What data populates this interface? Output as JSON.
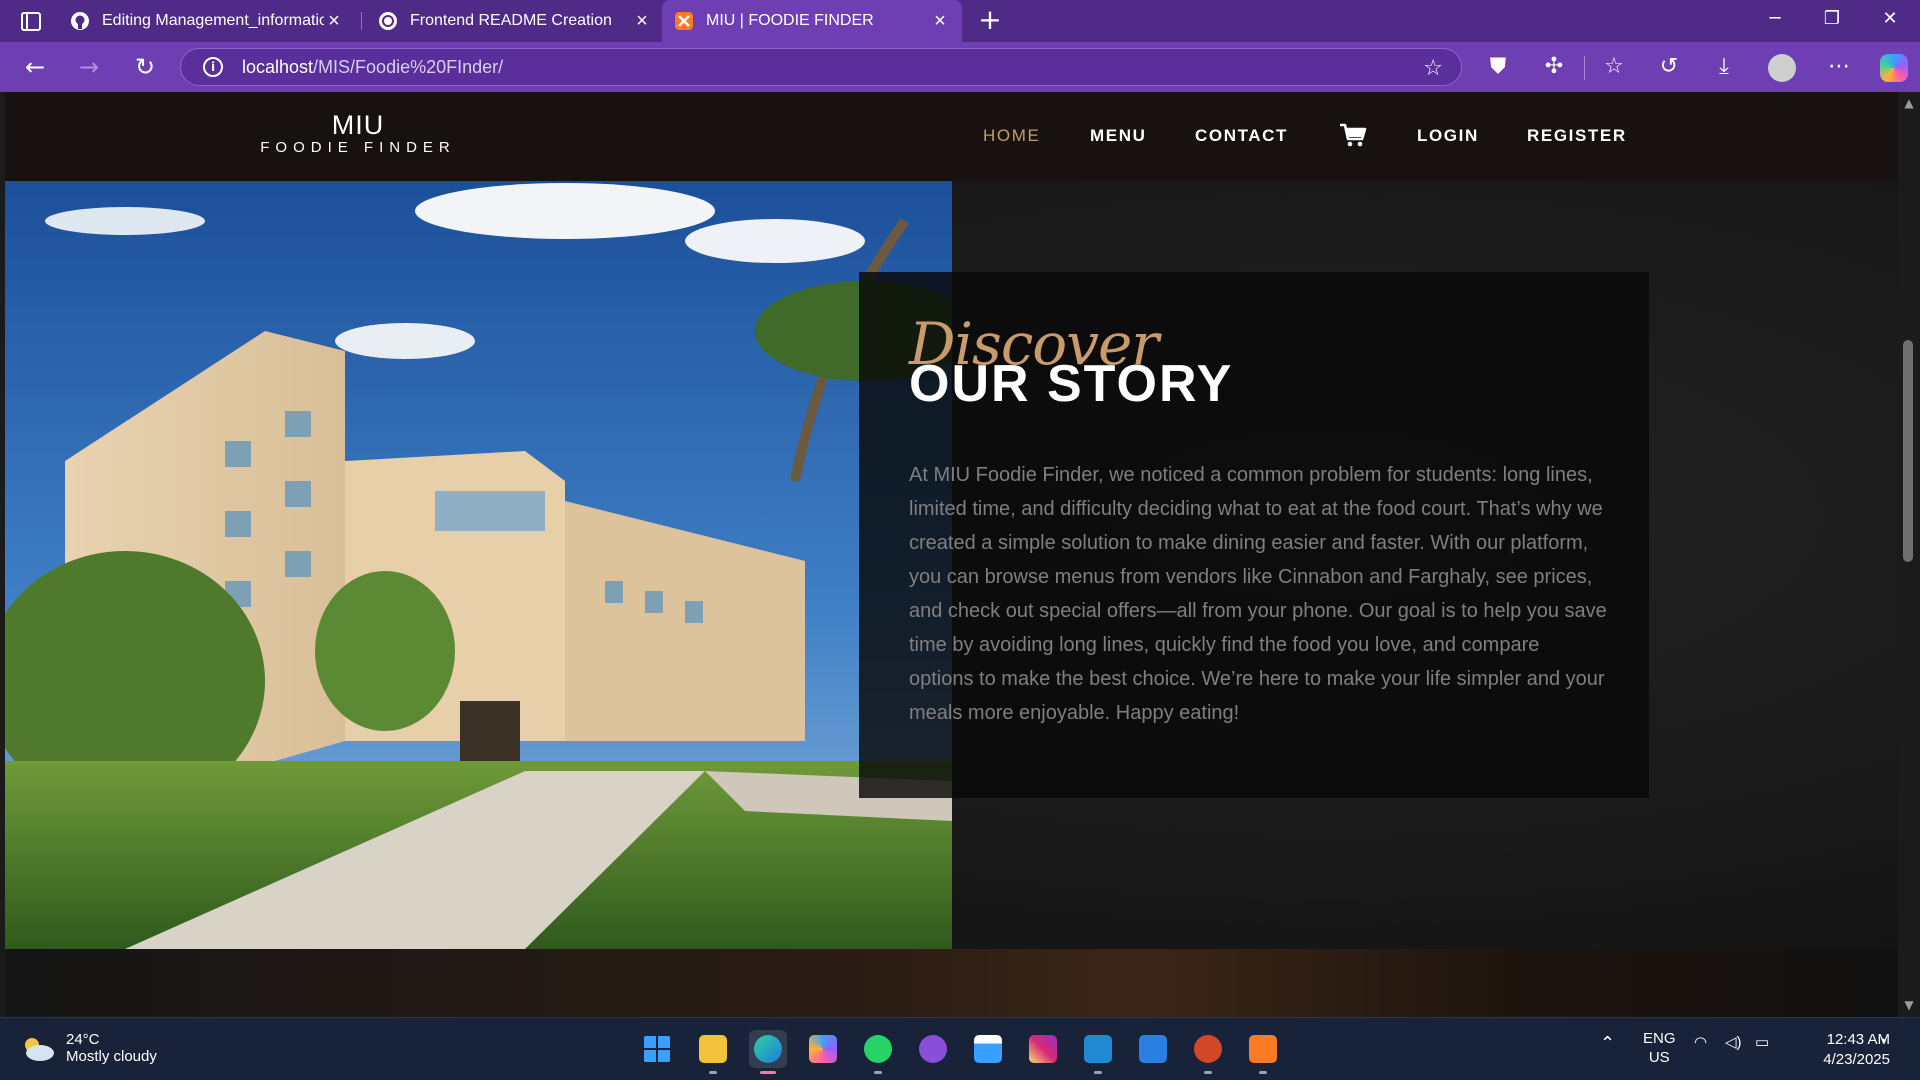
{
  "browser": {
    "tabs": [
      {
        "title": "Editing Management_information",
        "icon": "github-icon",
        "active": false
      },
      {
        "title": "Frontend README Creation",
        "icon": "chatgpt-icon",
        "active": false
      },
      {
        "title": "MIU | FOODIE FINDER",
        "icon": "xampp-icon",
        "active": true
      }
    ],
    "address": {
      "host": "localhost",
      "path": "/MIS/Foodie%20FInder/"
    }
  },
  "site": {
    "logo_line1": "MIU",
    "logo_line2": "FOODIE FINDER",
    "nav": {
      "home": "HOME",
      "menu": "MENU",
      "contact": "CONTACT",
      "login": "LOGIN",
      "register": "REGISTER"
    },
    "accent_color": "#c99a6b"
  },
  "story": {
    "script_heading": "Discover",
    "heading": "OUR STORY",
    "body": "At MIU Foodie Finder, we noticed a common problem for students: long lines, limited time, and difficulty deciding what to eat at the food court. That’s why we created a simple solution to make dining easier and faster. With our platform, you can browse menus from vendors like Cinnabon and Farghaly, see prices, and check out special offers—all from your phone. Our goal is to help you save time by avoiding long lines, quickly find the food you love, and compare options to make the best choice. We’re here to make your life simpler and your meals more enjoyable. Happy eating!"
  },
  "taskbar": {
    "weather_temp": "24°C",
    "weather_desc": "Mostly cloudy",
    "lang": "ENG",
    "region": "US",
    "time": "12:43 AM",
    "date": "4/23/2025"
  }
}
